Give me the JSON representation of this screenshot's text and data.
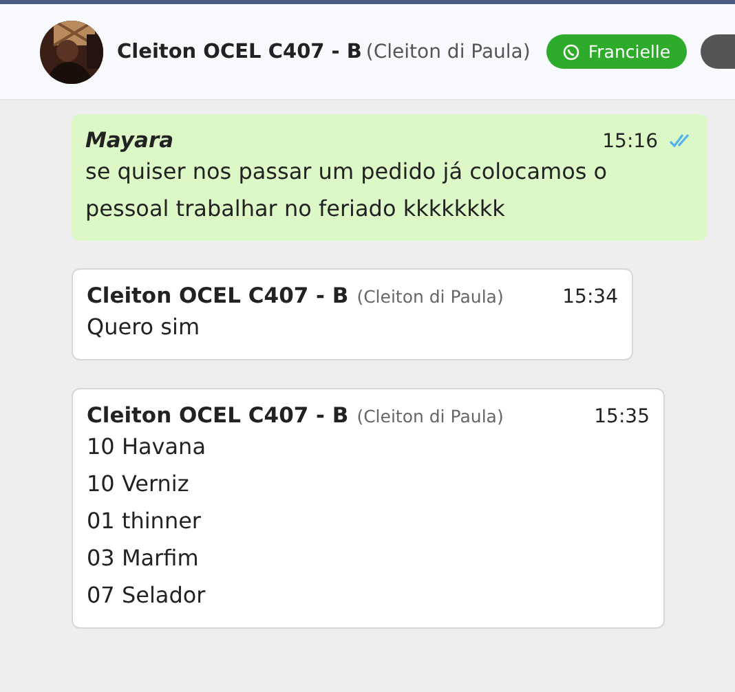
{
  "header": {
    "contact_name": "Cleiton OCEL C407 - B",
    "contact_alias": "(Cleiton di Paula)",
    "channel_button": "Francielle"
  },
  "messages": [
    {
      "kind": "sent",
      "author": "Mayara",
      "time": "15:16",
      "read": true,
      "lines": [
        "se quiser nos passar um pedido já colocamos o pessoal trabalhar no feriado kkkkkkkk"
      ]
    },
    {
      "kind": "received",
      "author": "Cleiton OCEL C407 - B",
      "alias": "(Cleiton di Paula)",
      "time": "15:34",
      "lines": [
        "Quero sim"
      ]
    },
    {
      "kind": "received",
      "author": "Cleiton OCEL C407 - B",
      "alias": "(Cleiton di Paula)",
      "time": "15:35",
      "lines": [
        "10 Havana",
        "10 Verniz",
        "01 thinner",
        "03 Marfim",
        "07 Selador"
      ]
    }
  ]
}
